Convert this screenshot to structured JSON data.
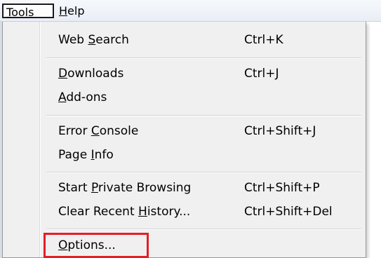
{
  "menubar": {
    "tools": {
      "pre": "",
      "key": "T",
      "post": "ools"
    },
    "help": {
      "pre": "",
      "key": "H",
      "post": "elp"
    }
  },
  "menu": {
    "items": [
      {
        "pre": "Web ",
        "key": "S",
        "post": "earch",
        "shortcut": "Ctrl+K"
      },
      {
        "pre": "",
        "key": "D",
        "post": "ownloads",
        "shortcut": "Ctrl+J"
      },
      {
        "pre": "",
        "key": "A",
        "post": "dd-ons",
        "shortcut": ""
      },
      {
        "pre": "Error ",
        "key": "C",
        "post": "onsole",
        "shortcut": "Ctrl+Shift+J"
      },
      {
        "pre": "Page ",
        "key": "I",
        "post": "nfo",
        "shortcut": ""
      },
      {
        "pre": "Start ",
        "key": "P",
        "post": "rivate Browsing",
        "shortcut": "Ctrl+Shift+P"
      },
      {
        "pre": "Clear Recent ",
        "key": "H",
        "post": "istory...",
        "shortcut": "Ctrl+Shift+Del"
      },
      {
        "pre": "",
        "key": "O",
        "post": "ptions...",
        "shortcut": ""
      }
    ]
  },
  "colors": {
    "highlight_border": "#e41e26"
  }
}
